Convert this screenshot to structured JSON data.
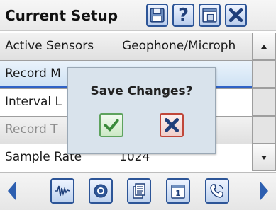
{
  "header": {
    "title": "Current Setup",
    "buttons": [
      {
        "icon": "save-disk-icon"
      },
      {
        "icon": "help-icon",
        "text": "?"
      },
      {
        "icon": "exit-window-icon"
      },
      {
        "icon": "close-icon"
      }
    ]
  },
  "rows": [
    {
      "label": "Active Sensors",
      "value": "Geophone/Microph"
    },
    {
      "label": "Record M",
      "value": ""
    },
    {
      "label": "Interval L",
      "value": ""
    },
    {
      "label": "Record T",
      "value": ""
    },
    {
      "label": "Sample Rate",
      "value": "1024"
    }
  ],
  "dialog": {
    "title": "Save Changes?"
  },
  "footer": {
    "buttons": [
      {
        "icon": "waveform-icon"
      },
      {
        "icon": "seal-icon"
      },
      {
        "icon": "documents-icon"
      },
      {
        "icon": "calendar-icon",
        "text": "1"
      },
      {
        "icon": "phone-icon"
      }
    ]
  },
  "colors": {
    "accent_blue": "#2d5597",
    "selection_underline": "#2f62c6",
    "ok_green": "#3a8a3a",
    "cancel_red": "#c0392b",
    "dialog_bg": "#d9e3ec"
  }
}
